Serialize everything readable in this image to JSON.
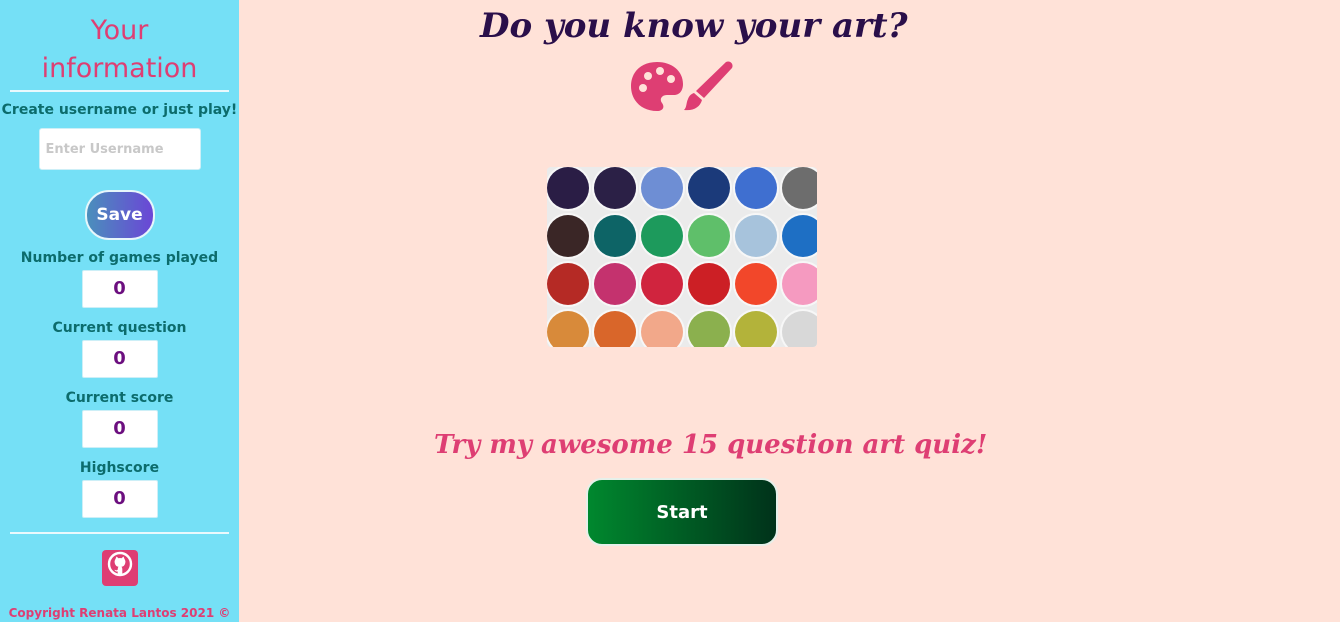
{
  "sidebar": {
    "title_line1": "Your",
    "title_line2": "information",
    "create_label": "Create username or just play!",
    "username_placeholder": "Enter Username",
    "save_label": "Save",
    "stats": [
      {
        "label": "Number of games played",
        "value": "0"
      },
      {
        "label": "Current question",
        "value": "0"
      },
      {
        "label": "Current score",
        "value": "0"
      },
      {
        "label": "Highscore",
        "value": "0"
      }
    ],
    "github_icon": "github-icon",
    "copyright": "Copyright Renata Lantos 2021 ©"
  },
  "main": {
    "title": "Do you know your art?",
    "title_icon": "palette-brush-icon",
    "tagline": "Try my awesome 15 question art quiz!",
    "start_label": "Start"
  },
  "colors": {
    "sidebar_bg": "#75e0f6",
    "page_bg": "#ffe2d8",
    "accent_pink": "#de3e73",
    "title_purple": "#2a0f4a",
    "start_green": "#00882e"
  }
}
